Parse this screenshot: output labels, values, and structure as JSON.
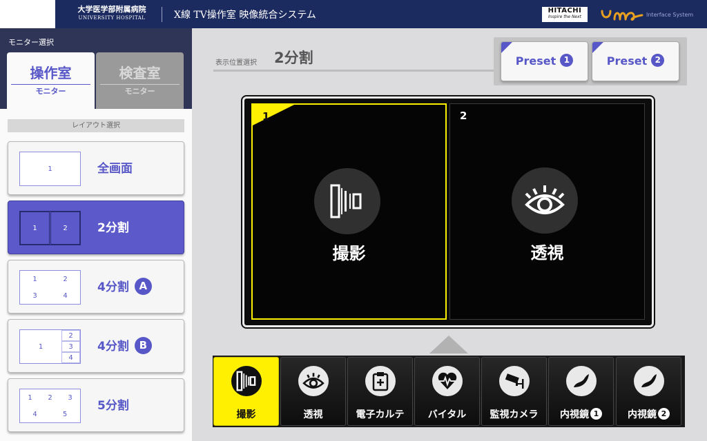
{
  "header": {
    "hospital_name": "大学医学部附属病院",
    "hospital_name_en": "UNIVERSITY HOSPITAL",
    "system_title": "X線 TV操作室 映像統合システム",
    "hitachi": "HITACHI",
    "hitachi_tagline": "Inspire the Next",
    "ume_text": "Interface System"
  },
  "monitor_select": {
    "title": "モニター選択",
    "tabs": [
      {
        "label": "操作室",
        "sub": "モニター",
        "active": true
      },
      {
        "label": "検査室",
        "sub": "モニター",
        "active": false
      }
    ]
  },
  "layout_select": {
    "title": "レイアウト選択",
    "items": [
      {
        "label": "全画面",
        "badge": "",
        "cells": [
          "1"
        ],
        "selected": false
      },
      {
        "label": "2分割",
        "badge": "",
        "cells": [
          "1",
          "2"
        ],
        "selected": true
      },
      {
        "label": "4分割",
        "badge": "A",
        "cells": [
          "1",
          "2",
          "3",
          "4"
        ],
        "selected": false
      },
      {
        "label": "4分割",
        "badge": "B",
        "cells": [
          "1",
          "2",
          "3",
          "4"
        ],
        "selected": false
      },
      {
        "label": "5分割",
        "badge": "",
        "cells": [
          "1",
          "2",
          "3",
          "4",
          "5"
        ],
        "selected": false
      }
    ]
  },
  "position": {
    "label": "表示位置選択",
    "value": "2分割"
  },
  "presets": [
    {
      "label": "Preset",
      "num": "1"
    },
    {
      "label": "Preset",
      "num": "2"
    }
  ],
  "screen": {
    "panes": [
      {
        "num": "1",
        "label": "撮影",
        "icon": "xray-shoot-icon",
        "selected": true
      },
      {
        "num": "2",
        "label": "透視",
        "icon": "eye-icon",
        "selected": false
      }
    ]
  },
  "sources": [
    {
      "label": "撮影",
      "num": "",
      "icon": "xray-shoot-icon",
      "selected": true
    },
    {
      "label": "透視",
      "num": "",
      "icon": "eye-icon",
      "selected": false
    },
    {
      "label": "電子カルテ",
      "num": "",
      "icon": "medical-chart-icon",
      "selected": false
    },
    {
      "label": "バイタル",
      "num": "",
      "icon": "heartbeat-icon",
      "selected": false
    },
    {
      "label": "監視カメラ",
      "num": "",
      "icon": "security-camera-icon",
      "selected": false
    },
    {
      "label": "内視鏡",
      "num": "1",
      "icon": "endoscope-icon",
      "selected": false
    },
    {
      "label": "内視鏡",
      "num": "2",
      "icon": "endoscope-icon",
      "selected": false
    }
  ],
  "colors": {
    "accent": "#5757c8",
    "header": "#1b2a5f",
    "highlight": "#ffef00"
  }
}
